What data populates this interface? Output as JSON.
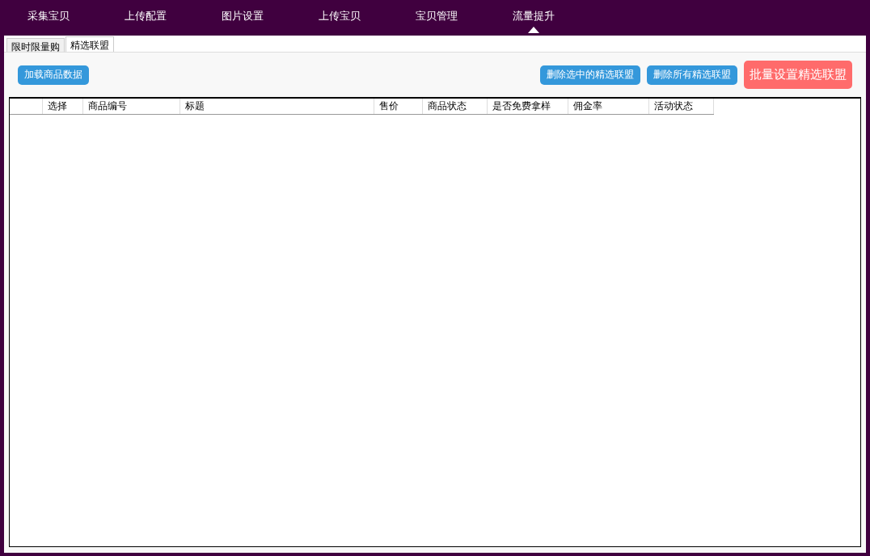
{
  "nav": [
    {
      "label": "采集宝贝",
      "selected": false
    },
    {
      "label": "上传配置",
      "selected": false
    },
    {
      "label": "图片设置",
      "selected": false
    },
    {
      "label": "上传宝贝",
      "selected": false
    },
    {
      "label": "宝贝管理",
      "selected": false
    },
    {
      "label": "流量提升",
      "selected": true
    }
  ],
  "tabs": [
    {
      "label": "限时限量购",
      "selected": false
    },
    {
      "label": "精选联盟",
      "selected": true
    }
  ],
  "toolbar": {
    "load_button": "加载商品数据",
    "right_buttons": [
      {
        "label": "删除选中的精选联盟",
        "kind": "normal"
      },
      {
        "label": "删除所有精选联盟",
        "kind": "normal"
      },
      {
        "label": "批量设置精选联盟",
        "kind": "primary"
      }
    ]
  },
  "table": {
    "columns": [
      "选择",
      "商品编号",
      "标题",
      "售价",
      "商品状态",
      "是否免费拿样",
      "佣金率",
      "活动状态"
    ]
  }
}
